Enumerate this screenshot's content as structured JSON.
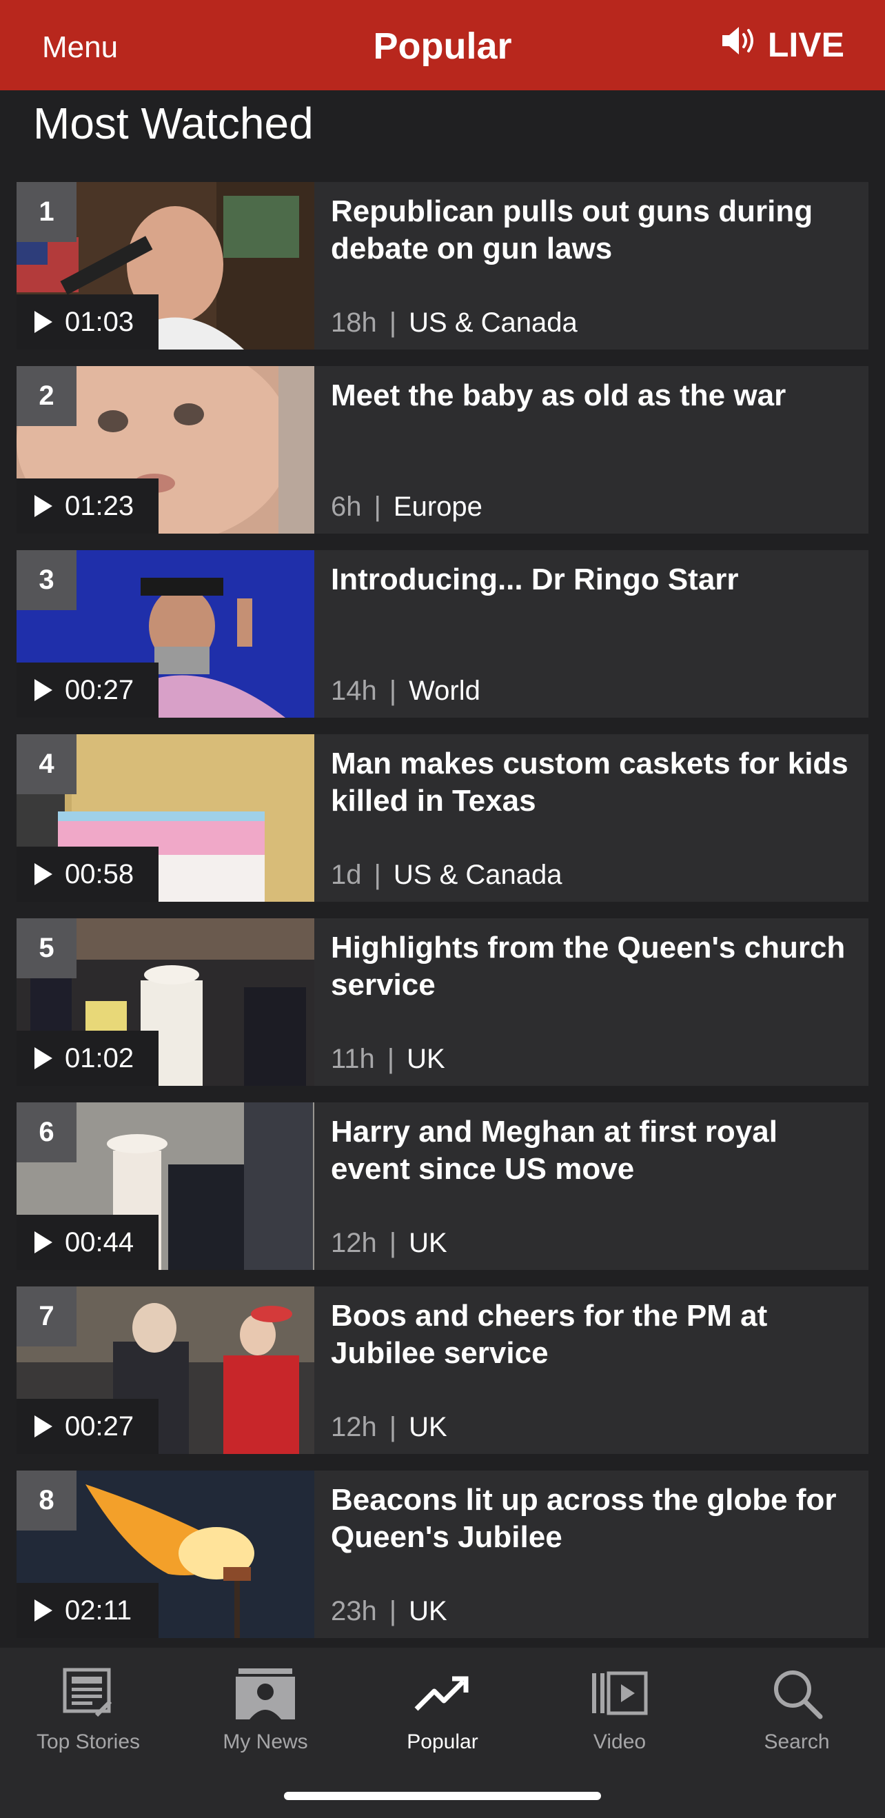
{
  "header": {
    "menu_label": "Menu",
    "title": "Popular",
    "live_label": "LIVE"
  },
  "section": {
    "heading": "Most Watched"
  },
  "items": [
    {
      "rank": "1",
      "duration": "01:03",
      "headline": "Republican pulls out guns during debate on gun laws",
      "time": "18h",
      "category": "US & Canada"
    },
    {
      "rank": "2",
      "duration": "01:23",
      "headline": "Meet the baby as old as the war",
      "time": "6h",
      "category": "Europe"
    },
    {
      "rank": "3",
      "duration": "00:27",
      "headline": "Introducing... Dr Ringo Starr",
      "time": "14h",
      "category": "World"
    },
    {
      "rank": "4",
      "duration": "00:58",
      "headline": "Man makes custom caskets for kids killed in Texas",
      "time": "1d",
      "category": "US & Canada"
    },
    {
      "rank": "5",
      "duration": "01:02",
      "headline": "Highlights from the Queen's church service",
      "time": "11h",
      "category": "UK"
    },
    {
      "rank": "6",
      "duration": "00:44",
      "headline": "Harry and Meghan at first royal event since US move",
      "time": "12h",
      "category": "UK"
    },
    {
      "rank": "7",
      "duration": "00:27",
      "headline": "Boos and cheers for the PM at Jubilee service",
      "time": "12h",
      "category": "UK"
    },
    {
      "rank": "8",
      "duration": "02:11",
      "headline": "Beacons lit up across the globe for Queen's Jubilee",
      "time": "23h",
      "category": "UK"
    }
  ],
  "tabs": [
    {
      "label": "Top Stories",
      "icon": "newspaper-icon"
    },
    {
      "label": "My News",
      "icon": "my-news-icon"
    },
    {
      "label": "Popular",
      "icon": "trending-icon",
      "active": true
    },
    {
      "label": "Video",
      "icon": "video-icon"
    },
    {
      "label": "Search",
      "icon": "search-icon"
    }
  ],
  "colors": {
    "brand_red": "#b8271d",
    "background": "#202022",
    "card": "#2d2d2f",
    "tab_bar": "#29292b"
  }
}
